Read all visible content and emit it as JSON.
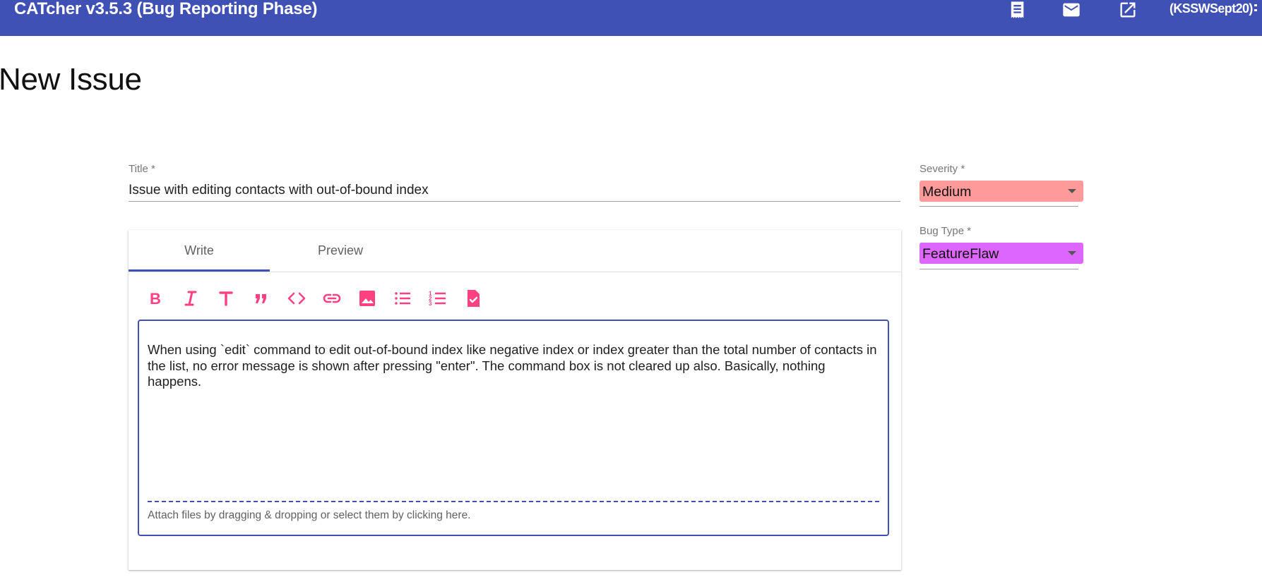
{
  "header": {
    "app_title": "CATcher v3.5.3  (Bug Reporting Phase)",
    "icons": [
      "receipt-icon",
      "mail-icon",
      "open-in-new-icon",
      "more-vert-icon"
    ],
    "user": "(KSSWSept20)",
    "bg_color": "#3f51b5"
  },
  "page": {
    "title": "New Issue"
  },
  "form": {
    "title_label": "Title *",
    "title_value": "Issue with editing contacts with out-of-bound index",
    "tabs": [
      {
        "label": "Write",
        "active": true
      },
      {
        "label": "Preview",
        "active": false
      }
    ],
    "toolbar": {
      "icons": [
        "bold-icon",
        "italic-icon",
        "header-icon",
        "quote-icon",
        "code-icon",
        "link-icon",
        "image-icon",
        "bulleted-list-icon",
        "numbered-list-icon",
        "task-list-icon"
      ],
      "accent_color": "#ff4081"
    },
    "description": "When using `edit` command to edit out-of-bound index like negative index or index greater than the total number of contacts in the list, no error message is shown after pressing \"enter\". The command box is not cleared up also. Basically, nothing happens.",
    "attach_hint": "Attach files by dragging & dropping or select them by clicking here."
  },
  "sidebar": {
    "severity": {
      "label": "Severity *",
      "value": "Medium",
      "color": "#ff9a9a"
    },
    "bug_type": {
      "label": "Bug Type *",
      "value": "FeatureFlaw",
      "color": "#dd66ff"
    }
  }
}
